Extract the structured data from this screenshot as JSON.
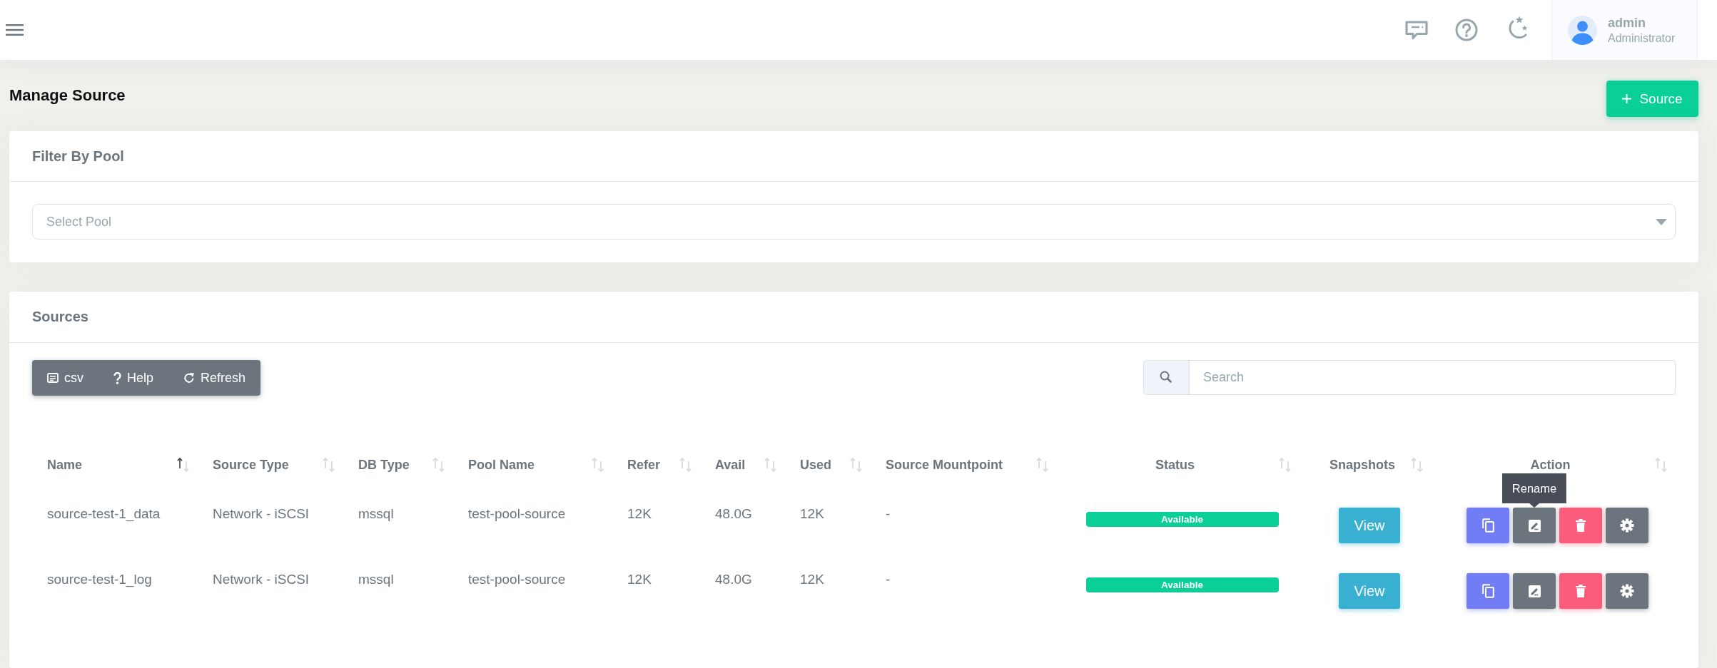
{
  "topbar": {
    "user": {
      "name": "admin",
      "role": "Administrator"
    }
  },
  "page": {
    "title": "Manage Source",
    "add_button": "Source"
  },
  "filter": {
    "title": "Filter By Pool",
    "select": {
      "placeholder": "Select Pool"
    }
  },
  "sources": {
    "title": "Sources",
    "toolbar": [
      {
        "kind": "csv",
        "label": "csv"
      },
      {
        "kind": "help",
        "label": "Help"
      },
      {
        "kind": "refresh",
        "label": "Refresh"
      }
    ],
    "search": {
      "placeholder": "Search"
    },
    "table": {
      "columns": [
        {
          "label": "Name",
          "kind": "text",
          "sorted": true
        },
        {
          "label": "Source Type",
          "kind": "text",
          "sorted": false
        },
        {
          "label": "DB Type",
          "kind": "text",
          "sorted": false
        },
        {
          "label": "Pool Name",
          "kind": "text",
          "sorted": false
        },
        {
          "label": "Refer",
          "kind": "text",
          "sorted": false
        },
        {
          "label": "Avail",
          "kind": "text",
          "sorted": false
        },
        {
          "label": "Used",
          "kind": "text",
          "sorted": false
        },
        {
          "label": "Source Mountpoint",
          "kind": "text",
          "sorted": false
        },
        {
          "label": "Status",
          "kind": "status",
          "sorted": false
        },
        {
          "label": "Snapshots",
          "kind": "button",
          "sorted": false
        },
        {
          "label": "Action",
          "kind": "actions",
          "sorted": false
        }
      ],
      "rows": [
        {
          "cells": [
            "source-test-1_data",
            "Network - iSCSI",
            "mssql",
            "test-pool-source",
            "12K",
            "48.0G",
            "12K",
            "-"
          ],
          "status": "Available",
          "snapshots": "View",
          "actions": [
            {
              "kind": "copy"
            },
            {
              "kind": "rename",
              "tooltip": "Rename"
            },
            {
              "kind": "delete"
            },
            {
              "kind": "settings"
            }
          ]
        },
        {
          "cells": [
            "source-test-1_log",
            "Network - iSCSI",
            "mssql",
            "test-pool-source",
            "12K",
            "48.0G",
            "12K",
            "-"
          ],
          "status": "Available",
          "snapshots": "View",
          "actions": [
            {
              "kind": "copy"
            },
            {
              "kind": "rename"
            },
            {
              "kind": "delete"
            },
            {
              "kind": "settings"
            }
          ]
        }
      ]
    }
  }
}
